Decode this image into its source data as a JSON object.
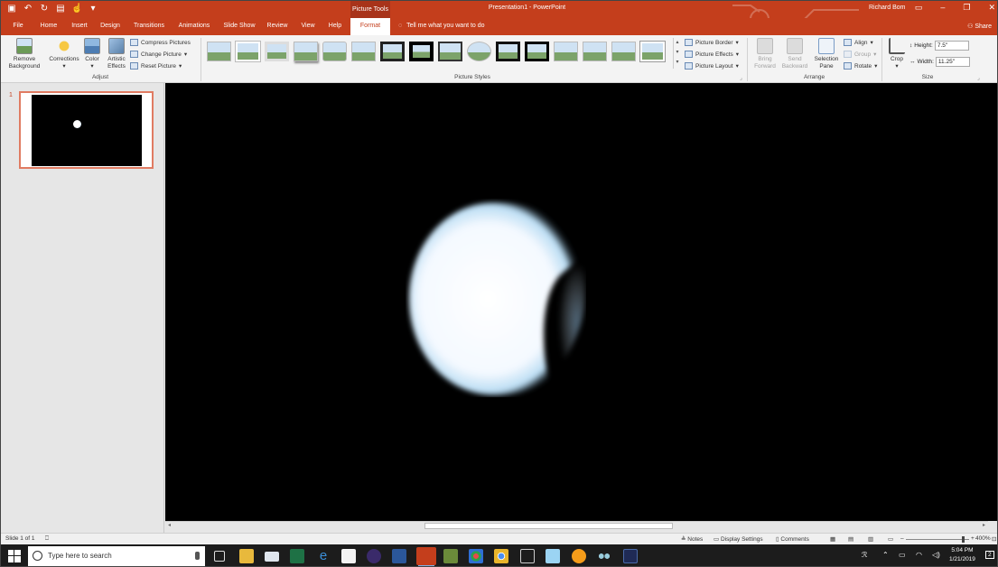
{
  "titlebar": {
    "context_tab_label": "Picture Tools",
    "doc_title": "Presentation1  -  PowerPoint",
    "user": "Richard Bom",
    "qat": [
      "save-icon",
      "undo-icon",
      "redo-icon",
      "present-icon",
      "touch-mode-icon",
      "customize-icon"
    ]
  },
  "tabs": [
    {
      "label": "File"
    },
    {
      "label": "Home"
    },
    {
      "label": "Insert"
    },
    {
      "label": "Design"
    },
    {
      "label": "Transitions"
    },
    {
      "label": "Animations"
    },
    {
      "label": "Slide Show"
    },
    {
      "label": "Review"
    },
    {
      "label": "View"
    },
    {
      "label": "Help"
    },
    {
      "label": "Format"
    }
  ],
  "tellme": "Tell me what you want to do",
  "share": "Share",
  "ribbon": {
    "adjust": {
      "label": "Adjust",
      "remove_bg_1": "Remove",
      "remove_bg_2": "Background",
      "corrections": "Corrections",
      "color": "Color",
      "artistic_1": "Artistic",
      "artistic_2": "Effects",
      "compress": "Compress Pictures",
      "change": "Change Picture",
      "reset": "Reset Picture"
    },
    "picture_styles": {
      "label": "Picture Styles",
      "border": "Picture Border",
      "effects": "Picture Effects",
      "layout": "Picture Layout"
    },
    "arrange": {
      "label": "Arrange",
      "bring_1": "Bring",
      "bring_2": "Forward",
      "send_1": "Send",
      "send_2": "Backward",
      "selection_1": "Selection",
      "selection_2": "Pane",
      "align": "Align",
      "group": "Group",
      "rotate": "Rotate"
    },
    "size": {
      "label": "Size",
      "crop": "Crop",
      "height_label": "Height:",
      "height_value": "7.5\"",
      "width_label": "Width:",
      "width_value": "11.25\""
    }
  },
  "slides": {
    "number": "1"
  },
  "status": {
    "slide": "Slide 1 of 1",
    "notes": "Notes",
    "display": "Display Settings",
    "comments": "Comments",
    "zoom": "400%"
  },
  "taskbar": {
    "search_placeholder": "Type here to search",
    "time": "5:04 PM",
    "date": "1/21/2019",
    "notification_count": "2"
  }
}
